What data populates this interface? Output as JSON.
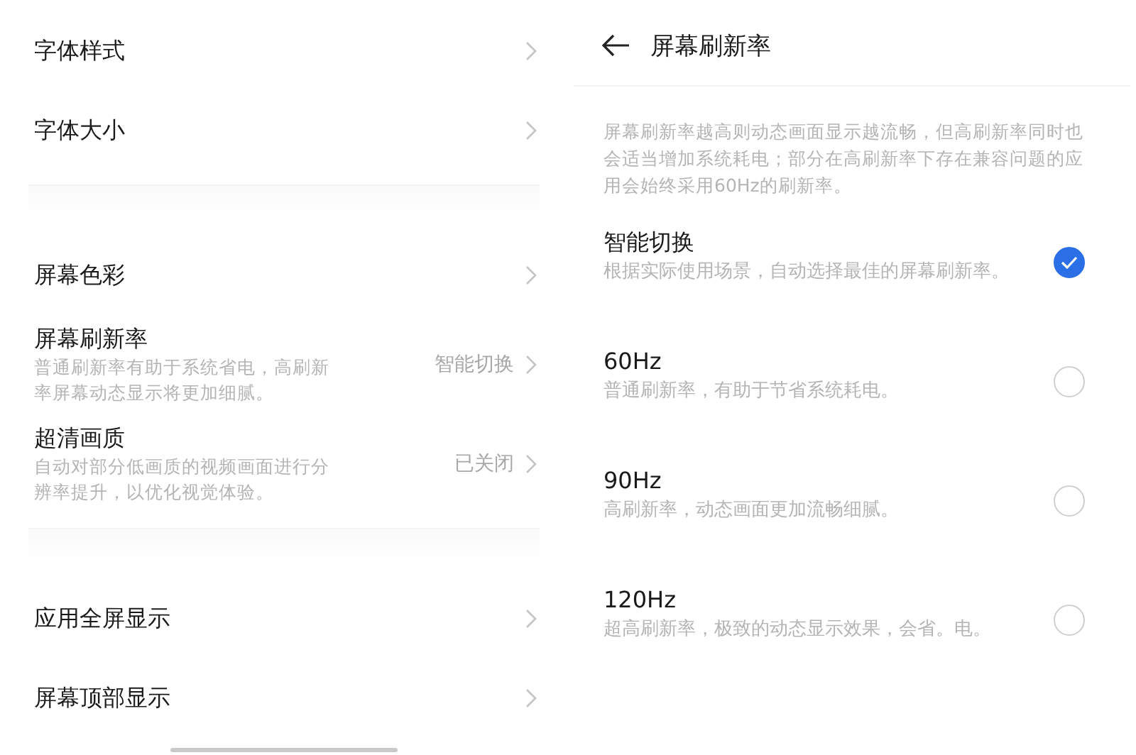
{
  "settings_groups": [
    {
      "items": [
        {
          "label": "字体样式"
        },
        {
          "label": "字体大小"
        }
      ]
    },
    {
      "items": [
        {
          "label": "屏幕色彩"
        },
        {
          "label": "屏幕刷新率",
          "description": "普通刷新率有助于系统省电，高刷新率屏幕动态显示将更加细腻。",
          "value": "智能切换"
        },
        {
          "label": "超清画质",
          "description": "自动对部分低画质的视频画面进行分辨率提升，以优化视觉体验。",
          "value": "已关闭"
        }
      ]
    },
    {
      "items": [
        {
          "label": "应用全屏显示"
        },
        {
          "label": "屏幕顶部显示"
        }
      ]
    }
  ],
  "detail": {
    "title": "屏幕刷新率",
    "intro": "屏幕刷新率越高则动态画面显示越流畅，但高刷新率同时也会适当增加系统耗电；部分在高刷新率下存在兼容问题的应用会始终采用60Hz的刷新率。",
    "options": [
      {
        "label": "智能切换",
        "description": "根据实际使用场景，自动选择最佳的屏幕刷新率。",
        "selected": true
      },
      {
        "label": "60Hz",
        "description": "普通刷新率，有助于节省系统耗电。",
        "selected": false
      },
      {
        "label": "90Hz",
        "description": "高刷新率，动态画面更加流畅细腻。",
        "selected": false
      },
      {
        "label": "120Hz",
        "description": "超高刷新率，极致的动态显示效果，会省。电。",
        "selected": false
      }
    ]
  }
}
